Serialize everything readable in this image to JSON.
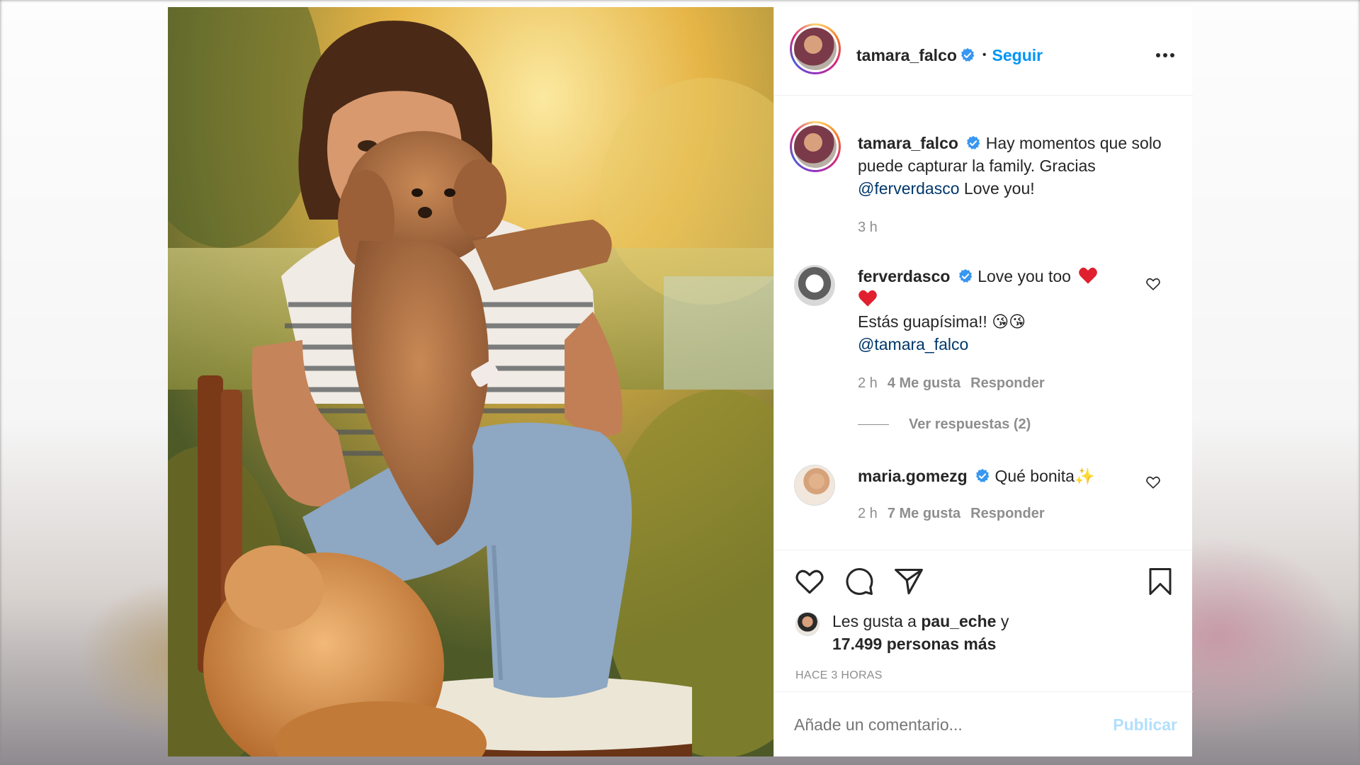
{
  "post": {
    "author": "tamara_falco",
    "follow_separator": "•",
    "follow_label": "Seguir",
    "more_label": "•••",
    "caption_author": "tamara_falco",
    "caption_text": "Hay momentos que solo puede capturar la family. Gracias",
    "caption_mention": "@ferverdasco",
    "caption_tail": "Love you!",
    "caption_time": "3 h"
  },
  "comments": [
    {
      "author": "ferverdasco",
      "text": "Love you too",
      "line2": "Estás guapísima!! 😘😘",
      "mention": "@tamara_falco",
      "time": "2 h",
      "likes": "4 Me gusta",
      "reply": "Responder",
      "view_replies": "Ver respuestas (2)"
    },
    {
      "author": "maria.gomezg",
      "text": "Qué bonita",
      "emoji": "✨",
      "time": "2 h",
      "likes": "7 Me gusta",
      "reply": "Responder"
    }
  ],
  "likes": {
    "prefix": "Les gusta a",
    "user": "pau_eche",
    "and": "y",
    "count": "17.499 personas más",
    "time_ago": "HACE 3 HORAS"
  },
  "comment_box": {
    "placeholder": "Añade un comentario...",
    "publish_label": "Publicar"
  },
  "colors": {
    "link": "#00376b",
    "accent": "#0095f6",
    "secondary": "#8e8e8e",
    "heart": "#ed4956"
  }
}
